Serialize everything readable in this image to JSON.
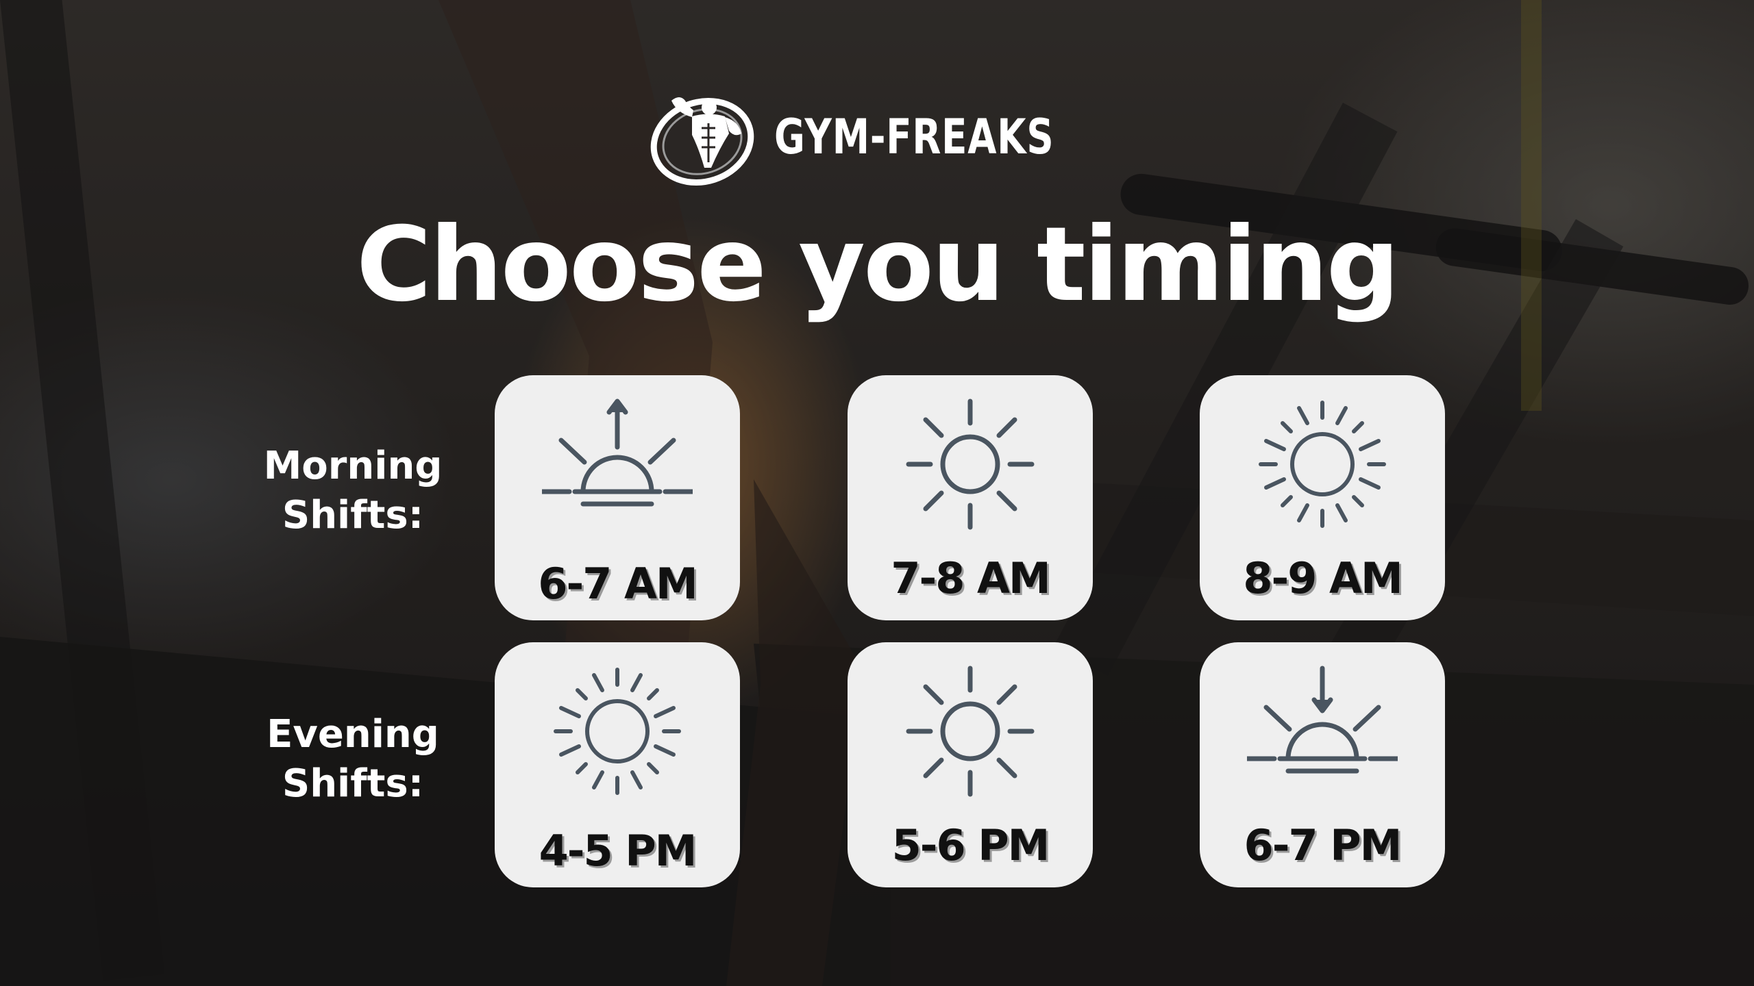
{
  "brand": {
    "name": "GYM-FREAKS",
    "logo_icon": "bodybuilder-emblem-icon"
  },
  "title": "Choose you timing",
  "shifts": {
    "morning": {
      "label_line1": "Morning",
      "label_line2": "Shifts:",
      "slots": [
        {
          "time": "6-7 AM",
          "icon": "sunrise-icon"
        },
        {
          "time": "7-8 AM",
          "icon": "sun-icon"
        },
        {
          "time": "8-9 AM",
          "icon": "bright-sun-icon"
        }
      ]
    },
    "evening": {
      "label_line1": "Evening",
      "label_line2": "Shifts:",
      "slots": [
        {
          "time": "4-5 PM",
          "icon": "bright-sun-icon"
        },
        {
          "time": "5-6 PM",
          "icon": "sun-icon"
        },
        {
          "time": "6-7 PM",
          "icon": "sunset-icon"
        }
      ]
    }
  },
  "colors": {
    "card_background": "#efefef",
    "icon_stroke": "#4a5560",
    "text_light": "#ffffff",
    "text_dark": "#111111"
  }
}
